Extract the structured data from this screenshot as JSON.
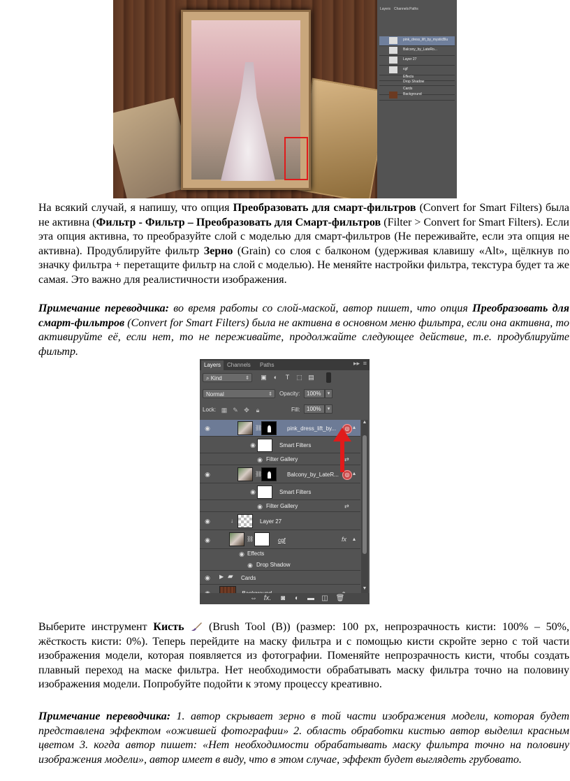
{
  "top_image": {
    "mini_panel": {
      "tabs": [
        "Layers",
        "Channels",
        "Paths"
      ],
      "rows": [
        "pink_dress_lift_by_mysticBlu",
        "Balcony_by_LateRo...",
        "Layer 27",
        "cgf",
        "Effects",
        "Drop Shadow",
        "Cards",
        "Background"
      ]
    }
  },
  "paragraph1": {
    "t1": "На всякий случай, я напишу, что опция ",
    "b1": "Преобразовать для смарт-фильтров",
    "t2": " (Convert for Smart Filters) была не активна (",
    "b2": "Фильтр - Фильтр – Преобразовать для Смарт-фильтров",
    "t3": " (Filter > Convert for Smart Filters). Если эта опция активна, то преобразуйте слой с моделью для смарт-фильтров (Не переживайте, если эта опция не активна). Продублируйте фильтр ",
    "b3": "Зерно",
    "t4": " (Grain) со слоя с балконом (удерживая клавишу «Alt», щёлкнув по значку фильтра + перетащите фильтр на слой с моделью). Не меняйте настройки фильтра, текстура будет та же самая. Это важно для реалистичности изображения."
  },
  "note1": {
    "label": "Примечание переводчика:",
    "t1": " во время работы со слой-маской, автор пишет, что опция ",
    "b1": "Преобразовать для смарт-фильтров",
    "t2": " (Convert for Smart Filters) была не активна в основном меню фильтра, если она активна, то активируйте её, если нет, то не переживайте, продолжайте следующее действие, т.е. продублируйте фильтр."
  },
  "layers_panel": {
    "tabs": [
      "Layers",
      "Channels",
      "Paths"
    ],
    "kind_filter": "Kind",
    "blend_mode": "Normal",
    "opacity_label": "Opacity:",
    "opacity_value": "100%",
    "lock_label": "Lock:",
    "fill_label": "Fill:",
    "fill_value": "100%",
    "layers": {
      "pink": "pink_dress_lift_by...",
      "pink_smart_filters": "Smart Filters",
      "pink_filter_gallery": "Filter Gallery",
      "balcony": "Balcony_by_LateR...",
      "balcony_smart_filters": "Smart Filters",
      "balcony_filter_gallery": "Filter Gallery",
      "layer27": "Layer 27",
      "cgf": "cgf",
      "effects": "Effects",
      "drop_shadow": "Drop Shadow",
      "cards": "Cards",
      "background": "Background"
    }
  },
  "paragraph2": {
    "t1": "Выберите инструмент ",
    "b1": "Кисть",
    "t2": " (Brush Tool (B)) (размер: 100 px, непрозрачность кисти: 100% – 50%, жёсткость кисти: 0%). Теперь перейдите на маску фильтра и с помощью кисти скройте зерно с той части изображения модели, которая появляется из фотографии. Поменяйте непрозрачность кисти, чтобы создать плавный переход на маске фильтра. Нет необходимости обрабатывать маску фильтра точно на половину изображения модели. Попробуйте подойти к этому процессу креативно."
  },
  "note2": {
    "label": "Примечание переводчика:",
    "text": " 1. автор скрывает зерно в той части изображения модели, которая будет представлена эффектом «ожившей фотографии» 2. область обработки кистью автор выделил красным цветом 3. когда автор пишет: «Нет необходимости обрабатывать маску фильтра точно на половину изображения модели», автор имеет в виду, что в этом случае, эффект будет выглядеть грубовато."
  }
}
